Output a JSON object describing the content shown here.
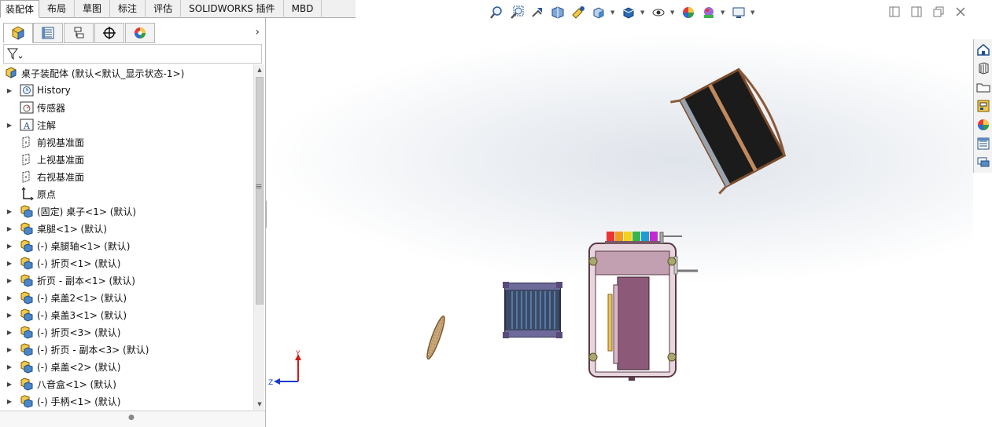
{
  "command_tabs": [
    {
      "label": "装配体",
      "active": true
    },
    {
      "label": "布局"
    },
    {
      "label": "草图"
    },
    {
      "label": "标注"
    },
    {
      "label": "评估"
    },
    {
      "label": "SOLIDWORKS 插件"
    },
    {
      "label": "MBD"
    }
  ],
  "panel_tabs": [
    {
      "icon": "featuremanager-icon",
      "active": true
    },
    {
      "icon": "propertymanager-icon"
    },
    {
      "icon": "configurationmanager-icon"
    },
    {
      "icon": "dimxpert-icon"
    },
    {
      "icon": "displaymanager-icon"
    }
  ],
  "tree": {
    "root": "桌子装配体 (默认<默认_显示状态-1>)",
    "items": [
      {
        "label": "History",
        "icon": "history-icon",
        "expandable": true
      },
      {
        "label": "传感器",
        "icon": "sensor-icon",
        "expandable": false
      },
      {
        "label": "注解",
        "icon": "annotation-icon",
        "expandable": true
      },
      {
        "label": "前视基准面",
        "icon": "plane-icon",
        "expandable": false
      },
      {
        "label": "上视基准面",
        "icon": "plane-icon",
        "expandable": false
      },
      {
        "label": "右视基准面",
        "icon": "plane-icon",
        "expandable": false
      },
      {
        "label": "原点",
        "icon": "origin-icon",
        "expandable": false
      },
      {
        "label": "(固定) 桌子<1> (默认)",
        "icon": "part-icon",
        "expandable": true
      },
      {
        "label": "桌腿<1> (默认)",
        "icon": "part-icon",
        "expandable": true
      },
      {
        "label": "(-) 桌腿轴<1> (默认)",
        "icon": "part-icon",
        "expandable": true
      },
      {
        "label": "(-) 折页<1> (默认)",
        "icon": "part-icon",
        "expandable": true
      },
      {
        "label": "折页 - 副本<1> (默认)",
        "icon": "part-icon",
        "expandable": true
      },
      {
        "label": "(-) 桌盖2<1> (默认)",
        "icon": "part-icon",
        "expandable": true
      },
      {
        "label": "(-) 桌盖3<1> (默认)",
        "icon": "part-icon",
        "expandable": true
      },
      {
        "label": "(-) 折页<3> (默认)",
        "icon": "part-icon",
        "expandable": true
      },
      {
        "label": "(-) 折页 - 副本<3> (默认)",
        "icon": "part-icon",
        "expandable": true
      },
      {
        "label": "(-) 桌盖<2> (默认)",
        "icon": "part-icon",
        "expandable": true
      },
      {
        "label": "八音盒<1> (默认)",
        "icon": "part-icon",
        "expandable": true
      },
      {
        "label": "(-) 手柄<1> (默认)",
        "icon": "part-icon",
        "expandable": true
      }
    ]
  },
  "heads_up_toolbar": [
    "zoom-to-fit-icon",
    "zoom-to-area-icon",
    "previous-view-icon",
    "section-view-icon",
    "dynamic-annotation-icon",
    "view-orientation-icon",
    "display-style-icon",
    "hide-show-items-icon",
    "edit-appearance-icon",
    "apply-scene-icon",
    "view-settings-icon"
  ],
  "window_controls": [
    "tile-left-icon",
    "tile-right-icon",
    "restore-icon",
    "close-icon"
  ],
  "task_pane": [
    "solidworks-resources-icon",
    "design-library-icon",
    "file-explorer-icon",
    "view-palette-icon",
    "appearances-icon",
    "custom-properties-icon",
    "forum-icon"
  ],
  "triad": {
    "y_label": "Y",
    "z_label": "Z"
  },
  "colors": {
    "accent": "#1f5fa8",
    "tab_bg": "#f0f0f0",
    "wood": "#c08a5e",
    "dark_panel": "#1e1e1e",
    "box": "#b88ea0"
  }
}
